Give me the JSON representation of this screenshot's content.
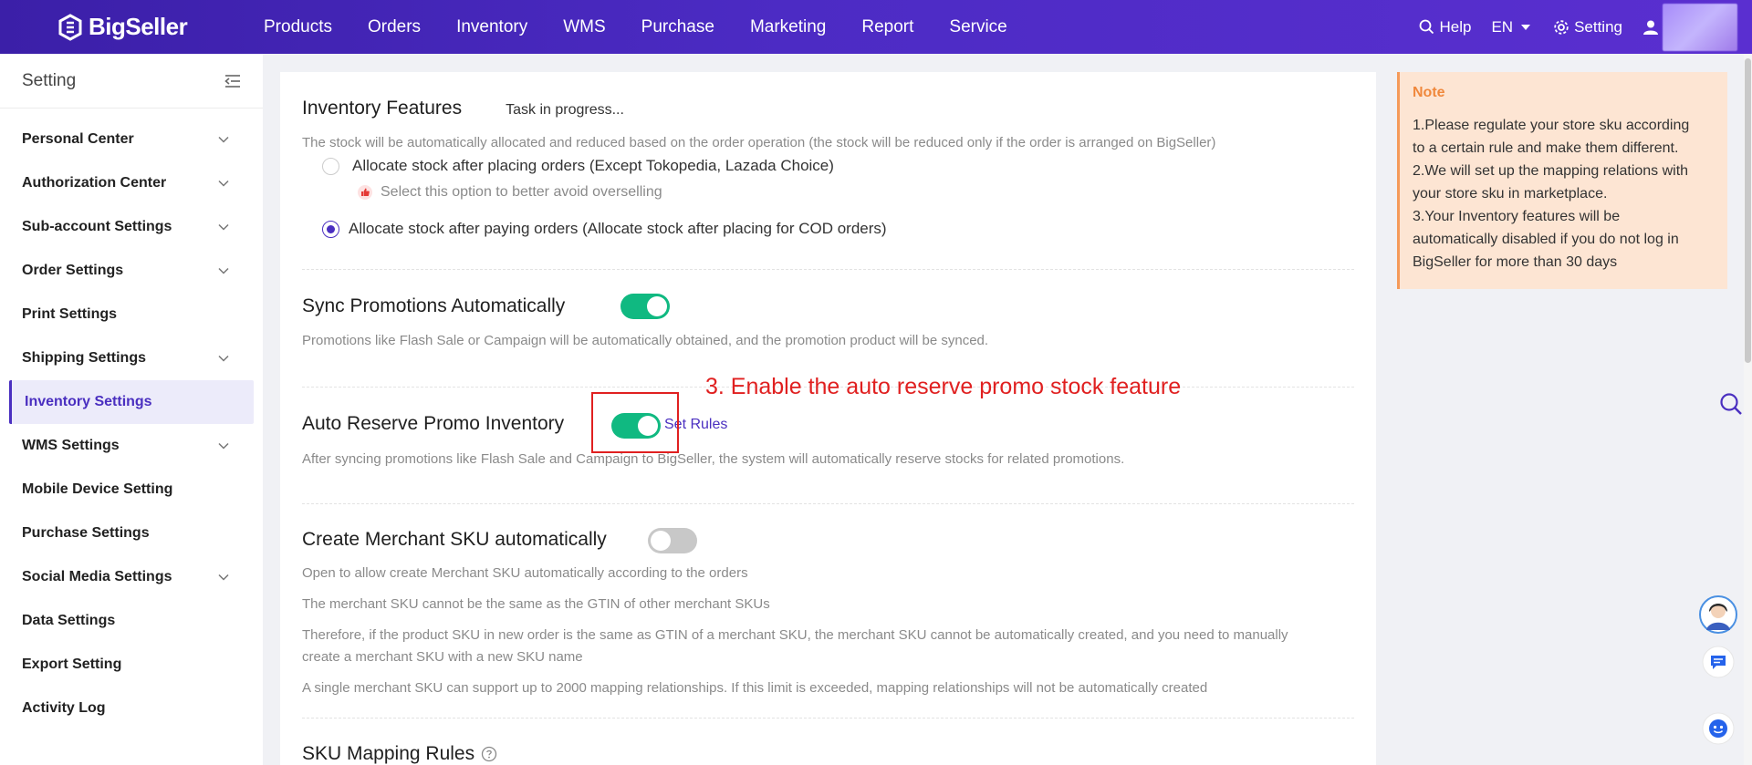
{
  "brand": {
    "name": "BigSeller"
  },
  "nav": [
    "Products",
    "Orders",
    "Inventory",
    "WMS",
    "Purchase",
    "Marketing",
    "Report",
    "Service"
  ],
  "topbar": {
    "help": "Help",
    "language": "EN",
    "setting": "Setting"
  },
  "sidebar": {
    "title": "Setting",
    "items": [
      {
        "label": "Personal Center",
        "expandable": true
      },
      {
        "label": "Authorization Center",
        "expandable": true
      },
      {
        "label": "Sub-account Settings",
        "expandable": true
      },
      {
        "label": "Order Settings",
        "expandable": true
      },
      {
        "label": "Print Settings",
        "expandable": false
      },
      {
        "label": "Shipping Settings",
        "expandable": true
      },
      {
        "label": "Inventory Settings",
        "expandable": false,
        "active": true
      },
      {
        "label": "WMS Settings",
        "expandable": true
      },
      {
        "label": "Mobile Device Setting",
        "expandable": false
      },
      {
        "label": "Purchase Settings",
        "expandable": false
      },
      {
        "label": "Social Media Settings",
        "expandable": true
      },
      {
        "label": "Data Settings",
        "expandable": false
      },
      {
        "label": "Export Setting",
        "expandable": false
      },
      {
        "label": "Activity Log",
        "expandable": false
      }
    ]
  },
  "inventory_features": {
    "title": "Inventory Features",
    "status": "Task in progress...",
    "desc": "The stock will be automatically allocated and reduced based on the order operation (the stock will be reduced only if the order is arranged on BigSeller)",
    "option1": "Allocate stock after placing orders (Except Tokopedia, Lazada Choice)",
    "option1_hint": "Select this option to better avoid overselling",
    "option2": "Allocate stock after paying orders (Allocate stock after placing for COD orders)",
    "selected": 2
  },
  "sync_promotions": {
    "title": "Sync Promotions Automatically",
    "enabled": true,
    "desc": "Promotions like Flash Sale or Campaign will be automatically obtained, and the promotion product will be synced."
  },
  "auto_reserve": {
    "title": "Auto Reserve Promo Inventory",
    "enabled": true,
    "link": "Set Rules",
    "desc": "After syncing promotions like Flash Sale and Campaign to BigSeller, the system will automatically reserve stocks for related promotions.",
    "annotation": "3. Enable the auto reserve promo stock feature"
  },
  "merchant_sku": {
    "title": "Create Merchant SKU automatically",
    "enabled": false,
    "desc1": "Open to allow create Merchant SKU automatically according to the orders",
    "desc2": "The merchant SKU cannot be the same as the GTIN of other merchant SKUs",
    "desc3a": "Therefore, if the product SKU in new order is the same as GTIN of a merchant SKU, the merchant SKU cannot be automatically created, and you need to manually",
    "desc3b": "create a merchant SKU with a new SKU name",
    "desc4": "A single merchant SKU can support up to 2000 mapping relationships. If this limit is exceeded, mapping relationships will not be automatically created"
  },
  "sku_mapping": {
    "title": "SKU Mapping Rules"
  },
  "note": {
    "title": "Note",
    "lines": [
      "1.Please regulate your store sku according",
      "to a certain rule and make them different.",
      "2.We will set up the mapping relations with",
      "your store sku in marketplace.",
      "3.Your Inventory features will be",
      "automatically disabled if you do not log in",
      "BigSeller for more than 30 days"
    ]
  },
  "colors": {
    "primary": "#4a2fc0",
    "toggle_on": "#10b981",
    "annotation": "#e02020",
    "note_bg": "#fde5d3",
    "note_title": "#f0883c"
  }
}
